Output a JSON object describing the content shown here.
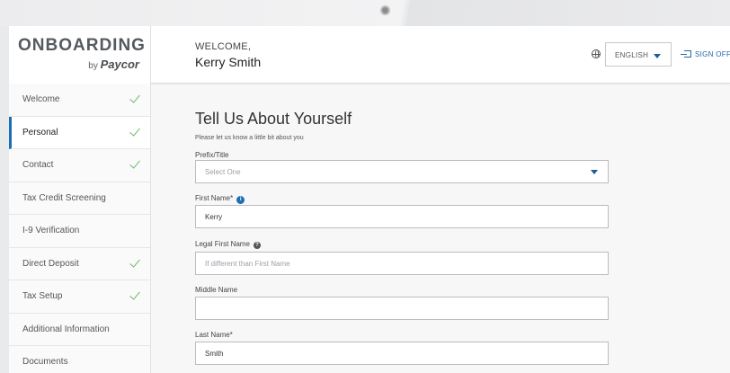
{
  "app": {
    "logo_main": "ONBOARDING",
    "logo_by": "by",
    "logo_brand": "Paycor"
  },
  "header": {
    "welcome_label": "WELCOME,",
    "user_name": "Kerry Smith",
    "language": "ENGLISH",
    "sign_off": "SIGN OFF",
    "globe_icon": "globe-icon",
    "sign_off_icon": "sign-out-icon"
  },
  "sidebar": {
    "items": [
      {
        "label": "Welcome",
        "done": true
      },
      {
        "label": "Personal",
        "done": true,
        "active": true
      },
      {
        "label": "Contact",
        "done": true
      },
      {
        "label": "Tax Credit Screening",
        "done": false
      },
      {
        "label": "I-9 Verification",
        "done": false
      },
      {
        "label": "Direct Deposit",
        "done": true
      },
      {
        "label": "Tax Setup",
        "done": true
      },
      {
        "label": "Additional Information",
        "done": false
      },
      {
        "label": "Documents",
        "done": false
      }
    ]
  },
  "form": {
    "title": "Tell Us About Yourself",
    "subtitle": "Please let us know a little bit about you",
    "prefix": {
      "label": "Prefix/Title",
      "placeholder": "Select One"
    },
    "first_name": {
      "label": "First Name*",
      "value": "Kerry",
      "info_glyph": "i"
    },
    "legal_first_name": {
      "label": "Legal First Name",
      "placeholder": "If different than First Name",
      "help_glyph": "?"
    },
    "middle_name": {
      "label": "Middle Name",
      "value": ""
    },
    "last_name": {
      "label": "Last Name*",
      "value": "Smith"
    }
  },
  "colors": {
    "accent": "#1b6fb5",
    "check": "#6cb96a",
    "link": "#2268ab"
  }
}
